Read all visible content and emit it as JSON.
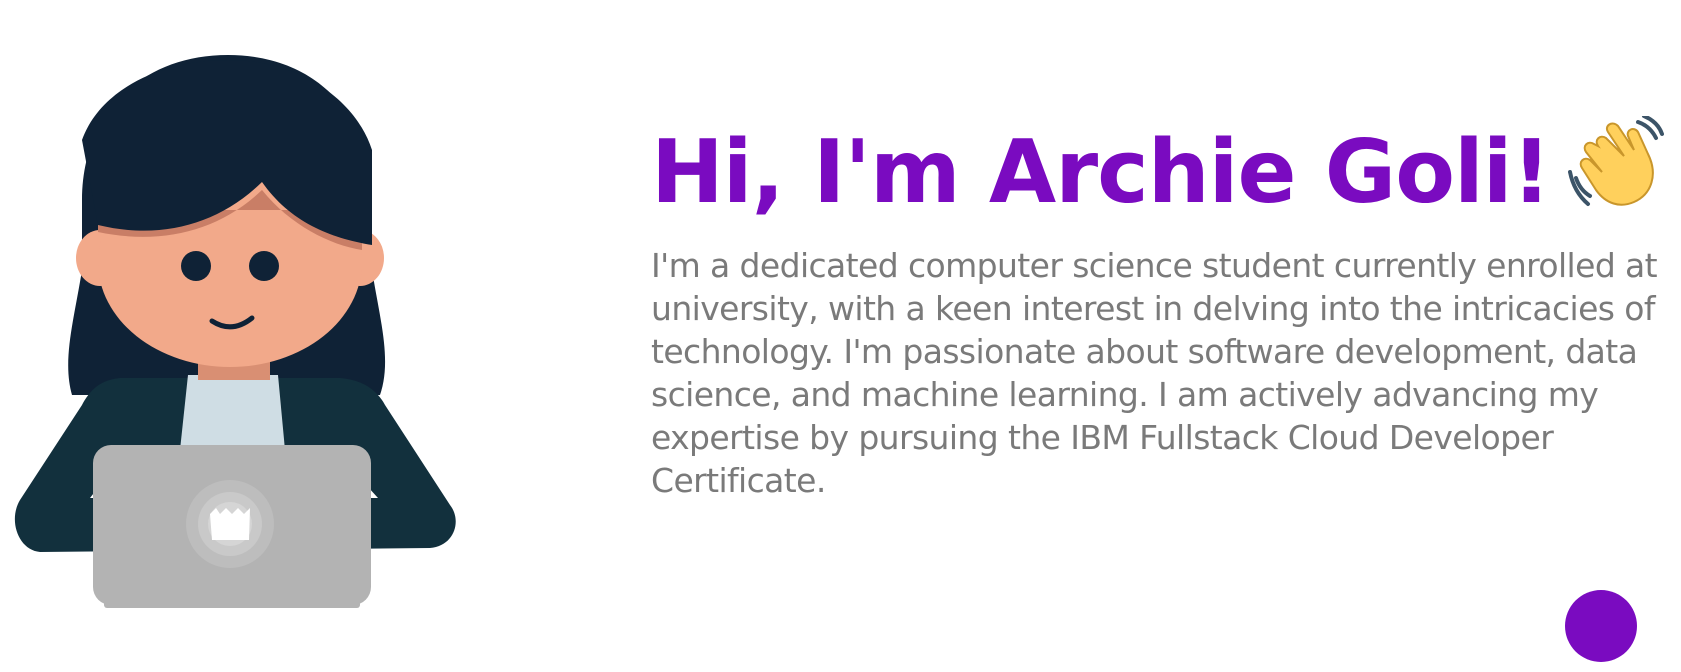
{
  "hero": {
    "headline": "Hi, I'm Archie Goli!",
    "wave_icon": "waving-hand-icon",
    "bio": "I'm a dedicated computer science student currently enrolled at university, with a keen interest in delving into the intricacies of technology. I'm passionate about software development, data science, and machine learning. I am actively advancing my expertise by pursuing the IBM Fullstack Cloud Developer Certificate.",
    "illustration_icon": "developer-avatar-illustration"
  },
  "floating_button": {
    "icon": "purple-circle-button"
  },
  "colors": {
    "accent": "#7a0bc0",
    "body_text": "#7a7a7a",
    "hair": "#0f2236",
    "skin": "#f2a98a",
    "jacket": "#12303d",
    "shirt": "#cfdde4",
    "laptop": "#b3b3b3"
  }
}
